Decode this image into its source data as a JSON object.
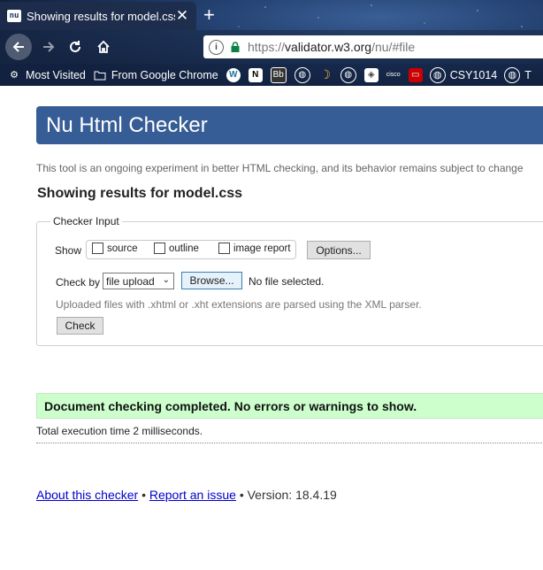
{
  "browser": {
    "tab_title": "Showing results for model.css",
    "tab_favicon": "nu",
    "url_prefix": "https://",
    "url_host": "validator.w3.org",
    "url_path": "/nu/#file",
    "bookmarks": [
      {
        "label": "Most Visited",
        "icon": "gear-icon"
      },
      {
        "label": "From Google Chrome",
        "icon": "folder-icon"
      }
    ],
    "bookmark_tail_label": "CSY1014",
    "bookmark_tail_initial": "T"
  },
  "page": {
    "title": "Nu Html Checker",
    "intro": "This tool is an ongoing experiment in better HTML checking, and its behavior remains subject to change",
    "results_heading": "Showing results for model.css",
    "checker_legend": "Checker Input",
    "show_label": "Show",
    "show_options": [
      "source",
      "outline",
      "image report"
    ],
    "options_button": "Options...",
    "checkby_label": "Check by",
    "checkby_value": "file upload",
    "browse_button": "Browse...",
    "no_file": "No file selected.",
    "xml_note": "Uploaded files with .xhtml or .xht extensions are parsed using the XML parser.",
    "check_button": "Check",
    "success_message": "Document checking completed. No errors or warnings to show.",
    "timing": "Total execution time 2 milliseconds.",
    "footer": {
      "about_link": "About this checker",
      "separator": "•",
      "report_link": "Report an issue",
      "version": "Version: 18.4.19"
    }
  },
  "colors": {
    "banner": "#365d95",
    "success_bg": "#ccffcc",
    "link": "#0000cc"
  }
}
